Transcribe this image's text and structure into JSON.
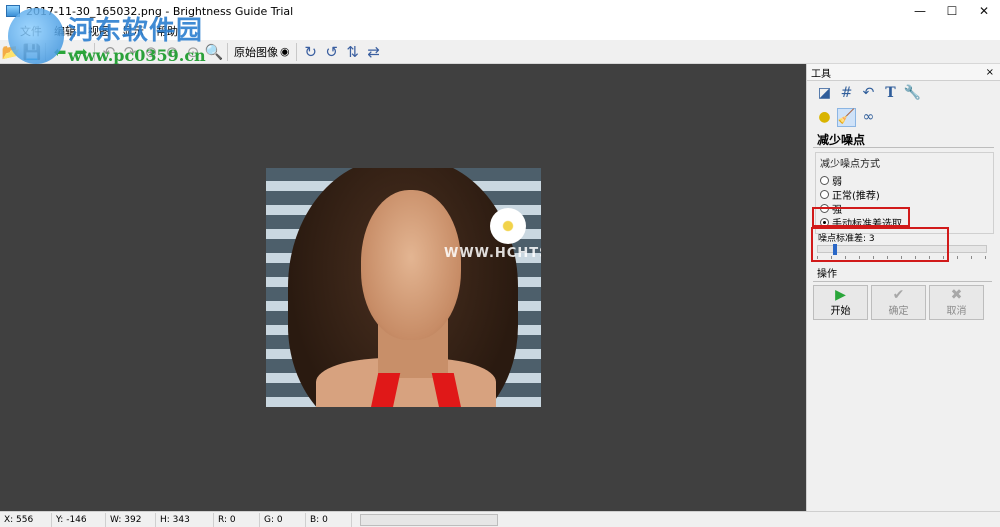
{
  "window": {
    "title": "2017-11-30_165032.png - Brightness Guide Trial",
    "controls": {
      "minimize": "—",
      "maximize": "☐",
      "close": "✕"
    }
  },
  "watermark": {
    "site_name": "河东软件园",
    "url": "www.pc0359.cn"
  },
  "menubar": {
    "items": [
      "文件",
      "编辑",
      "视图",
      "显示",
      "帮助"
    ]
  },
  "toolbar": {
    "original_image_label": "原始图像"
  },
  "canvas": {
    "photo_watermark": "WWW.HCHTS.NET"
  },
  "panel": {
    "header_title": "工具",
    "close_label": "×",
    "tool_title": "减少噪点",
    "method_group_label": "减少噪点方式",
    "methods": [
      {
        "label": "弱",
        "checked": false
      },
      {
        "label": "正常(推荐)",
        "checked": false
      },
      {
        "label": "强",
        "checked": false
      },
      {
        "label": "手动标准差选取",
        "checked": true
      }
    ],
    "std_label": "噪点标准差: 3",
    "std_value": 3,
    "ops_label": "操作",
    "buttons": {
      "start": "开始",
      "ok": "确定",
      "cancel": "取消"
    }
  },
  "statusbar": {
    "x": "X: 556",
    "y": "Y: -146",
    "w": "W: 392",
    "h": "H: 343",
    "r": "R: 0",
    "g": "G: 0",
    "b": "B: 0"
  }
}
